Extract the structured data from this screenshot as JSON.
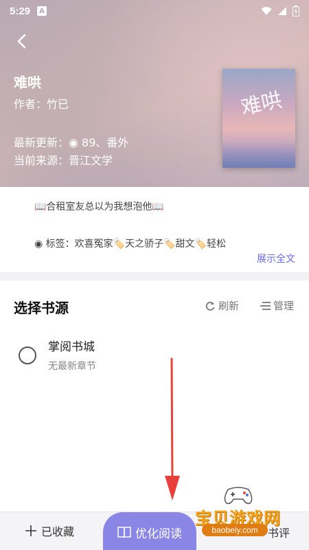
{
  "status": {
    "time": "5:29",
    "a_badge": "A"
  },
  "book": {
    "title": "难哄",
    "author": "作者：竹已",
    "latest_update": "最新更新：◉ 89、番外",
    "current_source": "当前来源：晋江文学",
    "cover_title": "难哄"
  },
  "intro": {
    "line": "📖合租室友总以为我想泡他📖",
    "tags": "◉ 标签：欢喜冤家🏷️天之骄子🏷️甜文🏷️轻松",
    "show_all": "展示全文"
  },
  "source_section": {
    "title": "选择书源",
    "refresh_label": "刷新",
    "manage_label": "管理",
    "items": [
      {
        "name": "掌阅书城",
        "latest": "无最新章节"
      }
    ]
  },
  "bottom_bar": {
    "collected_label": "已收藏",
    "read_label": "优化阅读",
    "review_label": "书评"
  },
  "watermark": {
    "text": "宝贝游戏网",
    "url": "baobeiy.com"
  },
  "colors": {
    "accent": "#8a86e6",
    "link": "#6b6be8",
    "arrow": "#e8413c"
  },
  "icons": {
    "back": "chevron-left-icon",
    "refresh": "refresh-icon",
    "manage": "menu-lines-icon",
    "collected": "plus-icon",
    "read": "book-icon"
  }
}
